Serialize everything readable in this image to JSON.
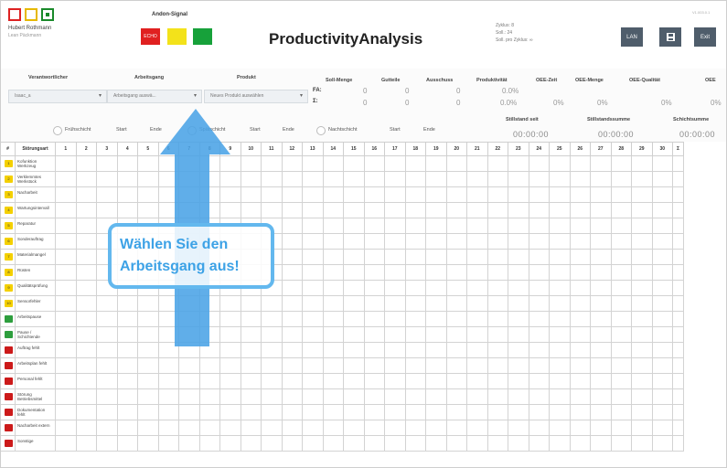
{
  "header": {
    "logo_name": "Hubert Rothmann",
    "logo_sub": "Lean Päckmann",
    "andon_label": "Andon-Signal",
    "signal_red_label": "ECHO",
    "title": "ProductivityAnalysis",
    "info_lines": [
      "Zyklus: 8",
      "Soll.: 24",
      "Soll. pro Zyklus: ∞"
    ],
    "version": "V1.003.0.1",
    "buttons": {
      "lan": "LAN",
      "exit": "Exit"
    }
  },
  "controls": {
    "labels": {
      "verantwortlicher": "Verantwortlicher",
      "arbeitsgang": "Arbeitsgang",
      "produkt": "Produkt",
      "soll_menge": "Soll-Menge",
      "gutteile": "Gutteile",
      "ausschuss": "Ausschuss",
      "produktivitaet": "Produktivität",
      "oee_zeit": "OEE-Zeit",
      "oee_menge": "OEE-Menge",
      "oee_qualitaet": "OEE-Qualität",
      "oee": "OEE"
    },
    "selects": {
      "verantwortlicher": "Isaac_a",
      "arbeitsgang": "Arbeitsgang auswä...",
      "produkt": "Neues Produkt auswählen"
    },
    "row_labels": {
      "fa": "FA:",
      "sum": "Σ:"
    },
    "row1": {
      "soll": "0",
      "gut": "0",
      "aus": "0",
      "prod": "0.0%"
    },
    "row2": {
      "soll": "0",
      "gut": "0",
      "aus": "0",
      "prod": "0.0%",
      "oee_zeit": "0%",
      "oee_menge": "0%",
      "oee_qual": "0%",
      "oee": "0%"
    },
    "shifts": [
      {
        "name": "Frühschicht",
        "start": "Start",
        "end": "Ende"
      },
      {
        "name": "Spätschicht",
        "start": "Start",
        "end": "Ende"
      },
      {
        "name": "Nachtschicht",
        "start": "Start",
        "end": "Ende"
      }
    ],
    "stoppage": [
      {
        "label": "Stillstand seit",
        "value": "00:00:00"
      },
      {
        "label": "Stillstandssumme",
        "value": "00:00:00"
      },
      {
        "label": "Schichtsumme",
        "value": "00:00:00"
      }
    ]
  },
  "grid": {
    "index_header": "#",
    "name_header": "Störungsart",
    "day_headers": [
      "1",
      "2",
      "3",
      "4",
      "5",
      "6",
      "7",
      "8",
      "9",
      "10",
      "11",
      "12",
      "13",
      "14",
      "15",
      "16",
      "17",
      "18",
      "19",
      "20",
      "21",
      "22",
      "23",
      "24",
      "25",
      "26",
      "27",
      "28",
      "29",
      "30"
    ],
    "sum_header": "Σ",
    "rows": [
      {
        "color": "yellow",
        "num": "1",
        "name": "Kofunktion Werkzeug"
      },
      {
        "color": "yellow",
        "num": "2",
        "name": "Verklemmtes Werkstück"
      },
      {
        "color": "yellow",
        "num": "3",
        "name": "Nacharbeit"
      },
      {
        "color": "yellow",
        "num": "4",
        "name": "Wartungsintervall"
      },
      {
        "color": "yellow",
        "num": "5",
        "name": "Reparatur"
      },
      {
        "color": "yellow",
        "num": "6",
        "name": "Sonderauftrag"
      },
      {
        "color": "yellow",
        "num": "7",
        "name": "Materialmangel"
      },
      {
        "color": "yellow",
        "num": "8",
        "name": "Rüsten"
      },
      {
        "color": "yellow",
        "num": "9",
        "name": "Qualitätsprüfung"
      },
      {
        "color": "yellow",
        "num": "10",
        "name": "Sensorfehler"
      },
      {
        "color": "green",
        "num": "",
        "name": "Arbeitspause"
      },
      {
        "color": "green",
        "num": "",
        "name": "Pause / Schichtende"
      },
      {
        "color": "red",
        "num": "",
        "name": "Auftrag fehlt"
      },
      {
        "color": "red",
        "num": "",
        "name": "Arbeitsplan fehlt"
      },
      {
        "color": "red",
        "num": "",
        "name": "Personal fehlt"
      },
      {
        "color": "red",
        "num": "",
        "name": "Störung Betriebsmittel"
      },
      {
        "color": "red",
        "num": "",
        "name": "Dokumentation fehlt"
      },
      {
        "color": "red",
        "num": "",
        "name": "Nacharbeit extern"
      },
      {
        "color": "red",
        "num": "",
        "name": "Sonstige"
      }
    ]
  },
  "callout": {
    "line1": "Wählen Sie den",
    "line2": "Arbeitsgang aus!"
  }
}
